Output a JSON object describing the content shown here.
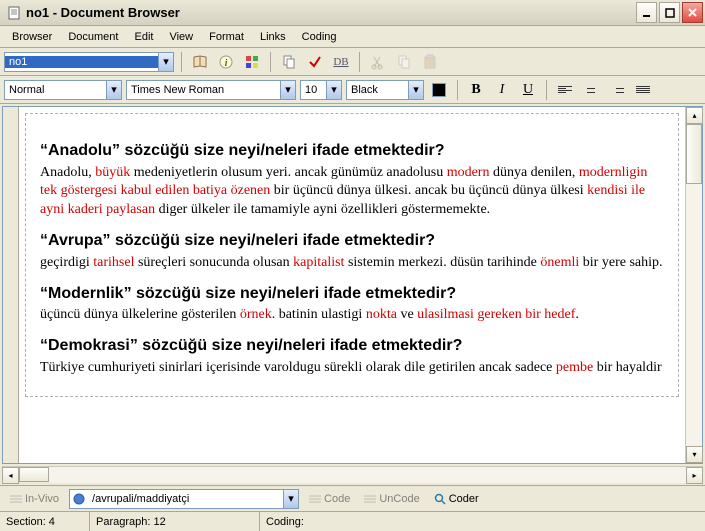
{
  "title": "no1 - Document Browser",
  "menu": [
    "Browser",
    "Document",
    "Edit",
    "View",
    "Format",
    "Links",
    "Coding"
  ],
  "toolbar1": {
    "doc_combo": "no1"
  },
  "fmt": {
    "style": "Normal",
    "font": "Times New Roman",
    "size": "10",
    "color": "Black"
  },
  "content": {
    "q1": {
      "heading": "“Anadolu” sözcüğü size neyi/neleri ifade etmektedir?"
    },
    "p1a": "Anadolu, ",
    "p1b": "büyük",
    "p1c": " medeniyetlerin olusum yeri. ancak günümüz anadolusu ",
    "p1d": "modern",
    "p1e": " dünya denilen, ",
    "p1f": "modernligin tek göstergesi kabul edilen batiya özenen",
    "p1g": " bir üçüncü dünya ülkesi. ancak bu üçüncü dünya ülkesi ",
    "p1h": "kendisi ile ayni kaderi paylasan",
    "p1i": " diger ülkeler ile tamamiyle ayni özellikleri göstermemekte.",
    "q2": {
      "heading": " “Avrupa” sözcüğü size neyi/neleri ifade etmektedir?"
    },
    "p2a": "geçirdigi ",
    "p2b": "tarihsel",
    "p2c": " süreçleri sonucunda olusan ",
    "p2d": "kapitalist",
    "p2e": " sistemin merkezi. düsün tarihinde ",
    "p2f": "önemli",
    "p2g": " bir yere sahip.",
    "q3": {
      "heading": "“Modernlik” sözcüğü size neyi/neleri ifade etmektedir?"
    },
    "p3a": "üçüncü dünya ülkelerine gösterilen ",
    "p3b": "örnek",
    "p3c": ". batinin ulastigi ",
    "p3d": "nokta",
    "p3e": " ve ",
    "p3f": "ulasilmasi gereken bir hedef",
    "p3g": ".",
    "q4": {
      "heading": "“Demokrasi” sözcüğü size neyi/neleri ifade etmektedir?"
    },
    "p4a": "Türkiye cumhuriyeti sinirlari içerisinde varoldugu sürekli olarak dile getirilen ancak sadece ",
    "p4b": "pembe",
    "p4c": " bir hayaldir"
  },
  "codebar": {
    "invivo": "In-Vivo",
    "path": "/avrupali/maddiyatçi",
    "code": "Code",
    "uncode": "UnCode",
    "coder": "Coder"
  },
  "status": {
    "section": "Section: 4",
    "paragraph": "Paragraph: 12",
    "coding": "Coding:"
  }
}
